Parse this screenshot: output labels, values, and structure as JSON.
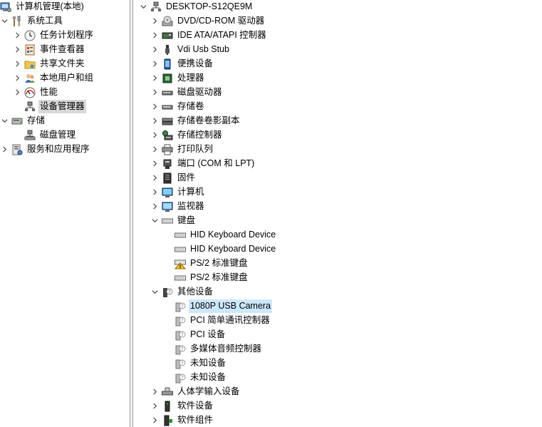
{
  "left_tree": {
    "root": "计算机管理(本地)",
    "system_tools": "系统工具",
    "task_scheduler": "任务计划程序",
    "event_viewer": "事件查看器",
    "shared_folders": "共享文件夹",
    "local_users": "本地用户和组",
    "performance": "性能",
    "device_manager": "设备管理器",
    "storage": "存储",
    "disk_management": "磁盘管理",
    "services_apps": "服务和应用程序"
  },
  "right_tree": {
    "computer_name": "DESKTOP-S12QE9M",
    "categories": {
      "dvd": "DVD/CD-ROM 驱动器",
      "ide": "IDE ATA/ATAPI 控制器",
      "vdi": "Vdi Usb Stub",
      "portable": "便携设备",
      "processor": "处理器",
      "disk_drives": "磁盘驱动器",
      "storage_volumes": "存储卷",
      "shadow_copies": "存储卷卷影副本",
      "storage_controllers": "存储控制器",
      "print_queues": "打印队列",
      "ports": "端口 (COM 和 LPT)",
      "firmware": "固件",
      "computer": "计算机",
      "monitors": "监视器",
      "keyboards": "键盘",
      "other_devices": "其他设备",
      "hid": "人体学输入设备",
      "software_devices": "软件设备",
      "software_components": "软件组件"
    },
    "keyboards_children": [
      "HID Keyboard Device",
      "HID Keyboard Device",
      "PS/2 标准键盘",
      "PS/2 标准键盘"
    ],
    "other_children": [
      "1080P USB Camera",
      "PCI 简单通讯控制器",
      "PCI 设备",
      "多媒体音频控制器",
      "未知设备",
      "未知设备"
    ]
  },
  "colors": {
    "selection_light": "#cce8ff",
    "selection_gray": "#d9d9d9",
    "divider": "#f0f0f0"
  }
}
